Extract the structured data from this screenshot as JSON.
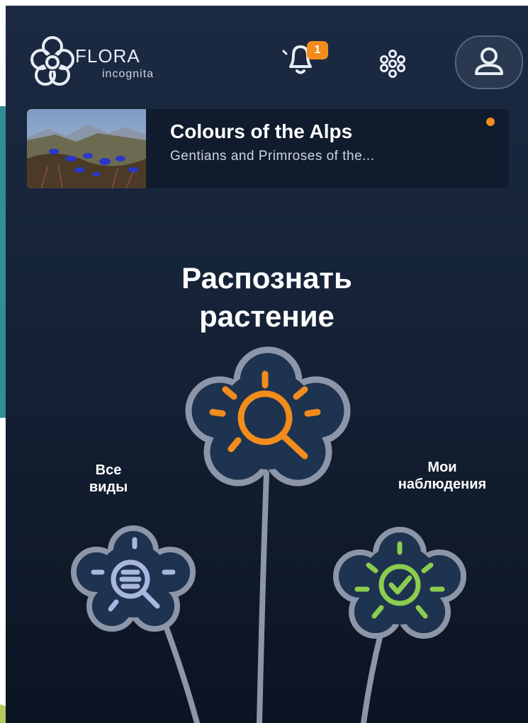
{
  "header": {
    "logo": {
      "title": "FLORA",
      "subtitle": "incognita"
    },
    "notifications": {
      "icon": "bell-icon",
      "count": "1"
    },
    "menu_icon": "flower-dots-icon",
    "profile_icon": "user-icon"
  },
  "featured_card": {
    "title": "Colours of the Alps",
    "subtitle": "Gentians and Primroses of the...",
    "image": "alpine-gentians-photo",
    "new_indicator_color": "#f28c1c"
  },
  "main": {
    "headline_line1": "Распознать",
    "headline_line2": "растение",
    "identify_button_icon": "magnifier-sun-icon",
    "all_species": {
      "label_line1": "Все",
      "label_line2": "виды",
      "icon": "list-search-icon"
    },
    "my_observations": {
      "label_line1": "Мои",
      "label_line2": "наблюдения",
      "icon": "check-circle-icon"
    }
  },
  "colors": {
    "accent_orange": "#f28c1c",
    "accent_green": "#8ccc4e",
    "accent_lavender": "#a9b6de",
    "flower_outline": "#8d96a8",
    "flower_fill": "#1d3350"
  }
}
